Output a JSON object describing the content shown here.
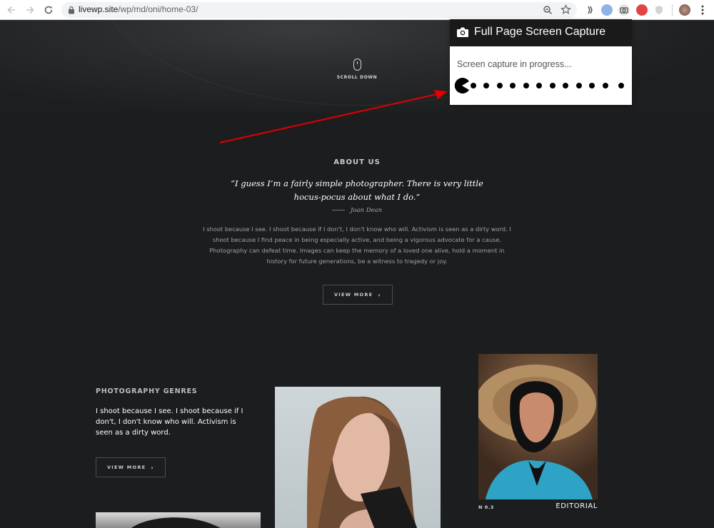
{
  "browser": {
    "url_host": "livewp.site",
    "url_path": "/wp/md/oni/home-03/"
  },
  "hero": {
    "scroll_label": "SCROLL DOWN"
  },
  "about": {
    "title": "ABOUT US",
    "quote_line1": "“I guess I’m a fairly simple photographer. There is very little",
    "quote_line2": "hocus-pocus about what I do.”",
    "author": "Joan Dean",
    "body": "I shoot because I see. I shoot because if I don't, I don't know who will. Activism is seen as a dirty word. I shoot because I find peace in being especially active, and being a vigorous advocate for a cause. Photography can defeat time. Images can keep the memory of a loved one alive, hold a moment in history for future generations, be a witness to tragedy or joy.",
    "button": "VIEW MORE"
  },
  "genres": {
    "title": "PHOTOGRAPHY GENRES",
    "body": "I shoot because I see. I shoot because if I don't, I don't know who will. Activism is seen as a dirty word.",
    "button": "VIEW MORE"
  },
  "gallery": {
    "caption_number": "N 0.3",
    "caption_label": "EDITORIAL"
  },
  "popup": {
    "title": "Full Page Screen Capture",
    "status": "Screen capture in progress..."
  },
  "colors": {
    "background": "#1c1d1f",
    "arrow": "#e00000",
    "popup_header": "#1a1a1a"
  }
}
